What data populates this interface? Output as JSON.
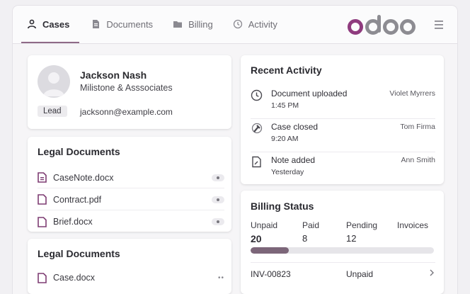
{
  "tabs": [
    {
      "label": "Cases",
      "icon": "user-icon",
      "active": true
    },
    {
      "label": "Documents",
      "icon": "document-icon",
      "active": false
    },
    {
      "label": "Billing",
      "icon": "folder-icon",
      "active": false
    },
    {
      "label": "Activity",
      "icon": "clock-icon",
      "active": false
    }
  ],
  "brand": {
    "logo_text": "odoo",
    "accent": "#8f6a87"
  },
  "contact": {
    "name": "Jackson Nash",
    "organization": "Milistone & Asssociates",
    "badge": "Lead",
    "email": "jacksonn@example.com"
  },
  "legal_documents": {
    "title": "Legal Documents",
    "items": [
      "CaseNote.docx",
      "Contract.pdf",
      "Brief.docx"
    ]
  },
  "legal_documents_2": {
    "title": "Legal Documents",
    "items": [
      "Case.docx"
    ]
  },
  "recent_activity": {
    "title": "Recent Activity",
    "items": [
      {
        "title": "Document uploaded",
        "time": "1:45 PM",
        "user": "Violet Myrrers",
        "icon": "clock-icon"
      },
      {
        "title": "Case closed",
        "time": "9:20 AM",
        "user": "Tom Firma",
        "icon": "gavel-icon"
      },
      {
        "title": "Note added",
        "time": "Yesterday",
        "user": "Ann Smith",
        "icon": "note-icon"
      }
    ]
  },
  "billing": {
    "title": "Billing Status",
    "columns": [
      {
        "label": "Unpaid",
        "value": "20"
      },
      {
        "label": "Paid",
        "value": "8"
      },
      {
        "label": "Pending",
        "value": "12"
      },
      {
        "label": "Invoices",
        "value": ""
      }
    ],
    "progress_fraction": 0.21,
    "invoice": {
      "id": "INV-00823",
      "status": "Unpaid"
    }
  }
}
